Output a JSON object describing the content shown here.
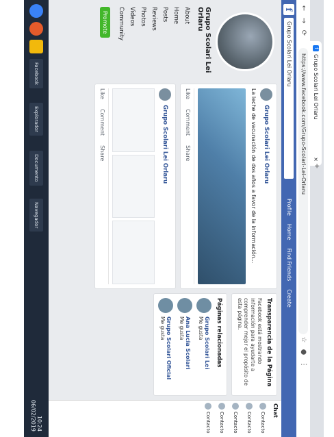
{
  "browser": {
    "tab_label": "Grupo Scolari Lei Orlaru",
    "address": "https://www.facebook.com/Grupo-Scolari-Lei-Orlaru",
    "nav": [
      "←",
      "→",
      "⟳"
    ]
  },
  "facebook": {
    "logo": "f",
    "search_value": "Grupo Scolari Lei Orlaru",
    "nav_items": [
      "Profile",
      "Home",
      "Find Friends",
      "Create"
    ]
  },
  "left_nav": {
    "page_name": "Grupo Scolari Lei Orlaru",
    "items": [
      "About",
      "Home",
      "Posts",
      "Reviews",
      "Photos",
      "Videos",
      "Community"
    ],
    "promote": "Promote"
  },
  "feed": {
    "post1": {
      "author": "Grupo Scolari Lei Orlaru",
      "text": "La leche de vacunación de dos años a favor de la información...",
      "actions": [
        "Like",
        "Comment",
        "Share"
      ]
    },
    "post2": {
      "author": "Grupo Scolari Lei Orlaru",
      "actions": [
        "Like",
        "Comment",
        "Share"
      ]
    }
  },
  "right": {
    "section1_title": "Transparencia de la Página",
    "section1_text": "Facebook está mostrando información para ayudarte a comprender mejor el propósito de esta página.",
    "section2_title": "Páginas relacionadas",
    "pages": [
      "Grupo Scolari Lei",
      "Ana Lucia Scolari",
      "Grupo Scolari Oficial"
    ],
    "like_label": "Me gusta"
  },
  "chat": {
    "title": "Chat",
    "contacts": [
      "Contacto",
      "Contacto",
      "Contacto",
      "Contacto",
      "Contacto"
    ]
  },
  "taskbar": {
    "apps": [
      "Facebook",
      "Explorador",
      "Documento",
      "Navegador"
    ],
    "time": "10:24",
    "date": "06/02/2019"
  },
  "colors": {
    "fb_blue": "#4267b2",
    "green": "#42b72a",
    "taskbar": "#1f2a3a"
  }
}
